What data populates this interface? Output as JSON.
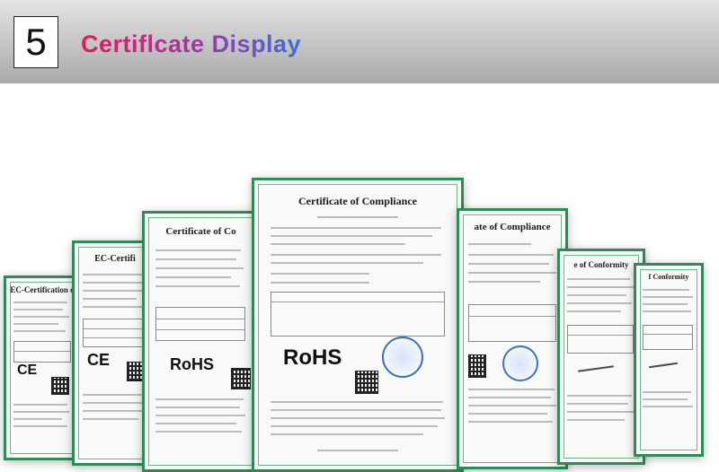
{
  "section": {
    "number": "5",
    "title": "Certiflcate Display"
  },
  "certificates": {
    "c1": {
      "title": "EC-Certification o"
    },
    "c2": {
      "title": "EC-Certifi",
      "mark": "CE"
    },
    "c3": {
      "title": "Certificate of Co",
      "mark": "RoHS"
    },
    "center": {
      "title": "Certificate of Compliance",
      "mark": "RoHS"
    },
    "c5": {
      "title": "ate of Compliance"
    },
    "c6": {
      "title": "e of Conformity"
    },
    "c7": {
      "title": "f Conformity"
    },
    "c1mark": "CE"
  },
  "colors": {
    "frame": "#2e8b57",
    "title_start": "#e8185a",
    "title_end": "#3f6fd9"
  }
}
